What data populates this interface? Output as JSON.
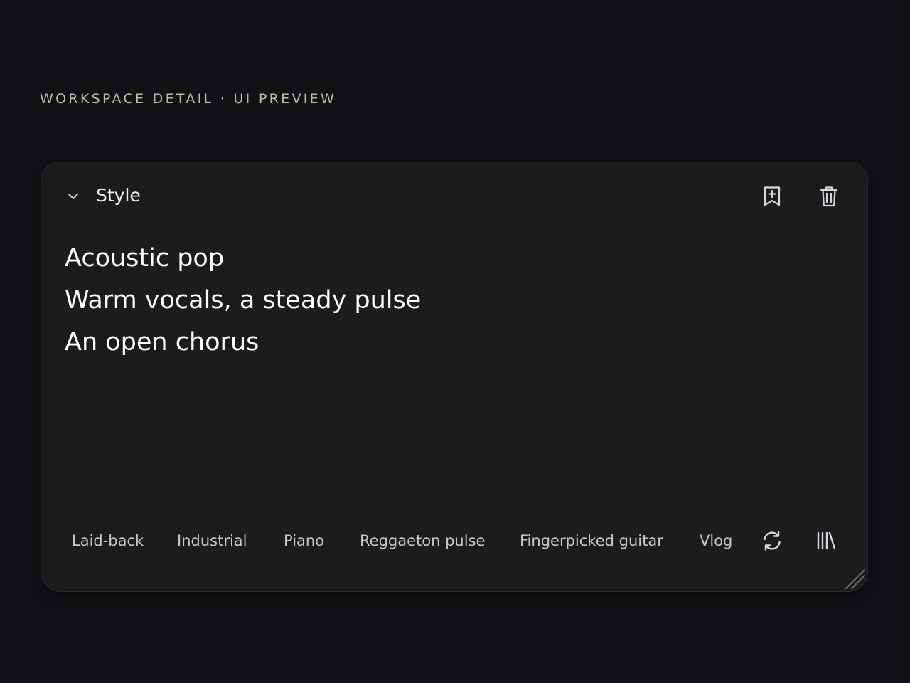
{
  "header": {
    "eyebrow": "WORKSPACE DETAIL · UI PREVIEW"
  },
  "style_panel": {
    "title": "Style",
    "collapse_icon": "chevron-down-icon",
    "actions": {
      "save_icon": "bookmark-plus-icon",
      "delete_icon": "trash-icon"
    },
    "prompt_lines": [
      "Acoustic pop",
      "Warm vocals, a steady pulse",
      "An open chorus"
    ],
    "tags": [
      "Laid-back",
      "Industrial",
      "Piano",
      "Reggaeton pulse",
      "Fingerpicked guitar",
      "Vlog"
    ],
    "tag_actions": {
      "refresh_icon": "refresh-icon",
      "library_icon": "library-icon"
    }
  },
  "colors": {
    "background": "#111215",
    "card": "#1c1c1e",
    "eyebrow": "#b9c0a0",
    "text_primary": "#ffffff",
    "text_secondary": "#c8c8cc"
  }
}
